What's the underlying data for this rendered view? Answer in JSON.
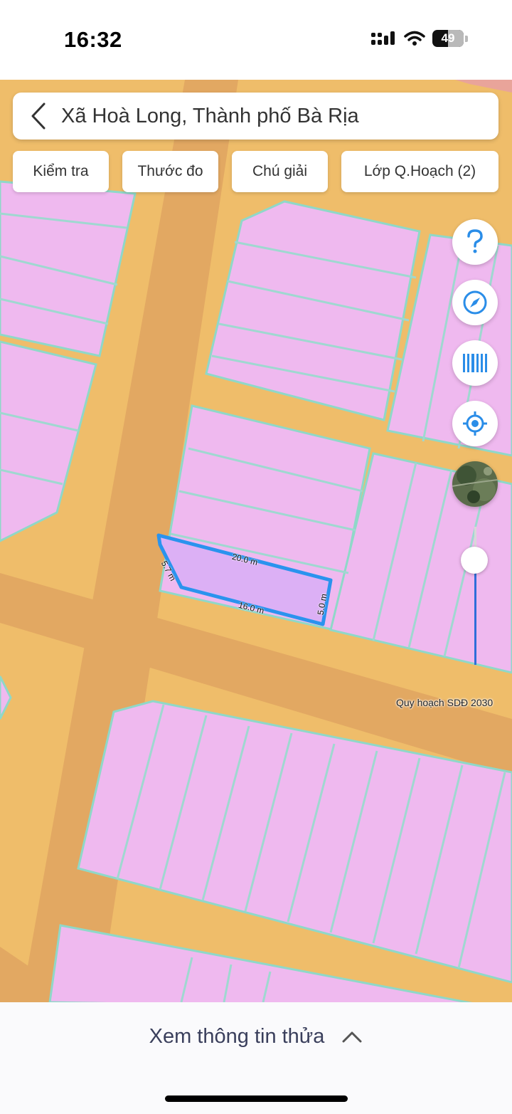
{
  "status_bar": {
    "time": "16:32",
    "battery": "49"
  },
  "search": {
    "text": "Xã Hoà Long, Thành phố Bà Rịa"
  },
  "chips": [
    {
      "label": "Kiểm tra"
    },
    {
      "label": "Thước đo"
    },
    {
      "label": "Chú giải"
    },
    {
      "label": "Lớp Q.Hoạch (2)"
    }
  ],
  "map": {
    "layer_label": "Quy hoạch SDĐ 2030",
    "colors": {
      "road": "#e2a862",
      "land": "#efbd6a",
      "residential": "#efb9ef",
      "parcel_lines": "#9fd8d0",
      "selection": "#2a93ee"
    },
    "measurements": [
      {
        "label": "20.0 m"
      },
      {
        "label": "5.7 m"
      },
      {
        "label": "16.0 m"
      },
      {
        "label": "5.0 m"
      }
    ]
  },
  "controls": {
    "help": "question-icon",
    "compass": "compass-icon",
    "barcode": "barcode-icon",
    "locate": "locate-icon",
    "satellite": "satellite-thumbnail",
    "opacity_slider_level": 0.75
  },
  "bottom": {
    "label": "Xem thông tin thửa"
  }
}
